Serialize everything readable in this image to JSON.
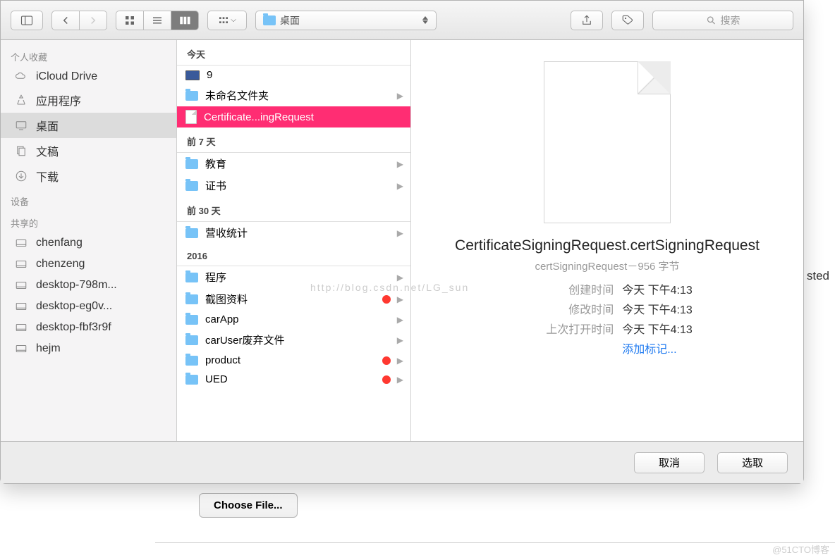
{
  "toolbar": {
    "path_label": "桌面",
    "search_placeholder": "搜索"
  },
  "sidebar": {
    "section_fav": "个人收藏",
    "section_dev": "设备",
    "section_shared": "共享的",
    "fav": [
      {
        "label": "iCloud Drive",
        "icon": "cloud"
      },
      {
        "label": "应用程序",
        "icon": "app"
      },
      {
        "label": "桌面",
        "icon": "desktop",
        "active": true
      },
      {
        "label": "文稿",
        "icon": "docs"
      },
      {
        "label": "下载",
        "icon": "download"
      }
    ],
    "shared": [
      {
        "label": "chenfang"
      },
      {
        "label": "chenzeng"
      },
      {
        "label": "desktop-798m..."
      },
      {
        "label": "desktop-eg0v..."
      },
      {
        "label": "desktop-fbf3r9f"
      },
      {
        "label": "hejm"
      }
    ]
  },
  "files": {
    "groups": [
      {
        "header": "今天",
        "items": [
          {
            "label": "9",
            "type": "img"
          },
          {
            "label": "未命名文件夹",
            "type": "folder",
            "arrow": true
          },
          {
            "label": "Certificate...ingRequest",
            "type": "file",
            "selected": true
          }
        ]
      },
      {
        "header": "前 7 天",
        "items": [
          {
            "label": "教育",
            "type": "folder",
            "arrow": true
          },
          {
            "label": "证书",
            "type": "folder",
            "arrow": true
          }
        ]
      },
      {
        "header": "前 30 天",
        "items": [
          {
            "label": "营收统计",
            "type": "folder",
            "arrow": true
          }
        ]
      },
      {
        "header": "2016",
        "items": [
          {
            "label": "程序",
            "type": "folder",
            "arrow": true
          },
          {
            "label": "截图资料",
            "type": "folder",
            "arrow": true,
            "dot": true
          },
          {
            "label": "carApp",
            "type": "folder",
            "arrow": true
          },
          {
            "label": "carUser废弃文件",
            "type": "folder",
            "arrow": true
          },
          {
            "label": "product",
            "type": "folder",
            "arrow": true,
            "dot": true
          },
          {
            "label": "UED",
            "type": "folder",
            "arrow": true,
            "dot": true
          }
        ]
      }
    ]
  },
  "preview": {
    "title": "CertificateSigningRequest.certSigningRequest",
    "subtitle": "certSigningRequest－956 字节",
    "created_k": "创建时间",
    "created_v": "今天 下午4:13",
    "modified_k": "修改时间",
    "modified_v": "今天 下午4:13",
    "opened_k": "上次打开时间",
    "opened_v": "今天 下午4:13",
    "add_tags": "添加标记..."
  },
  "footer": {
    "cancel": "取消",
    "choose": "选取"
  },
  "behind": "d. Yo\ny def\nsted",
  "choose_file": "Choose File...",
  "watermark": "http://blog.csdn.net/LG_sun",
  "corner": "@51CTO博客"
}
